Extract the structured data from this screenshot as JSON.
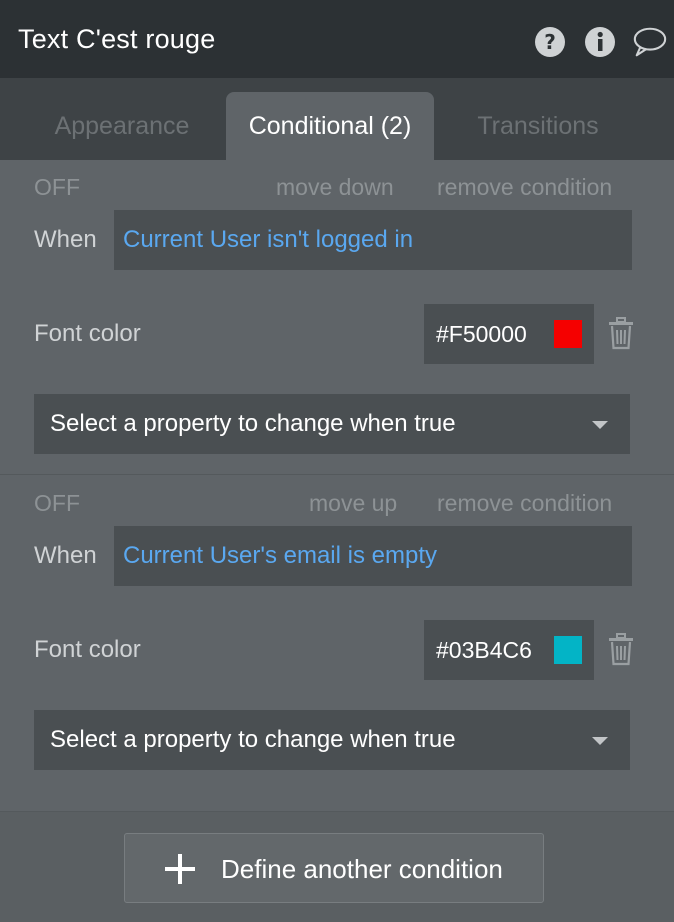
{
  "header": {
    "title": "Text C'est rouge",
    "icons": [
      "help-icon",
      "info-icon",
      "comment-icon"
    ]
  },
  "tabs": [
    {
      "label": "Appearance",
      "active": false
    },
    {
      "label": "Conditional (2)",
      "active": true
    },
    {
      "label": "Transitions",
      "active": false
    }
  ],
  "conditions": [
    {
      "status": "OFF",
      "move_label": "move down",
      "remove_label": "remove condition",
      "when_label": "When",
      "expression": "Current User isn't logged in",
      "property_label": "Font color",
      "color_value": "#F50000",
      "swatch_color": "#F50000",
      "select_placeholder": "Select a property to change when true"
    },
    {
      "status": "OFF",
      "move_label": "move up",
      "remove_label": "remove condition",
      "when_label": "When",
      "expression": "Current User's email is empty",
      "property_label": "Font color",
      "color_value": "#03B4C6",
      "swatch_color": "#03B4C6",
      "select_placeholder": "Select a property to change when true"
    }
  ],
  "footer": {
    "define_label": "Define another condition"
  }
}
